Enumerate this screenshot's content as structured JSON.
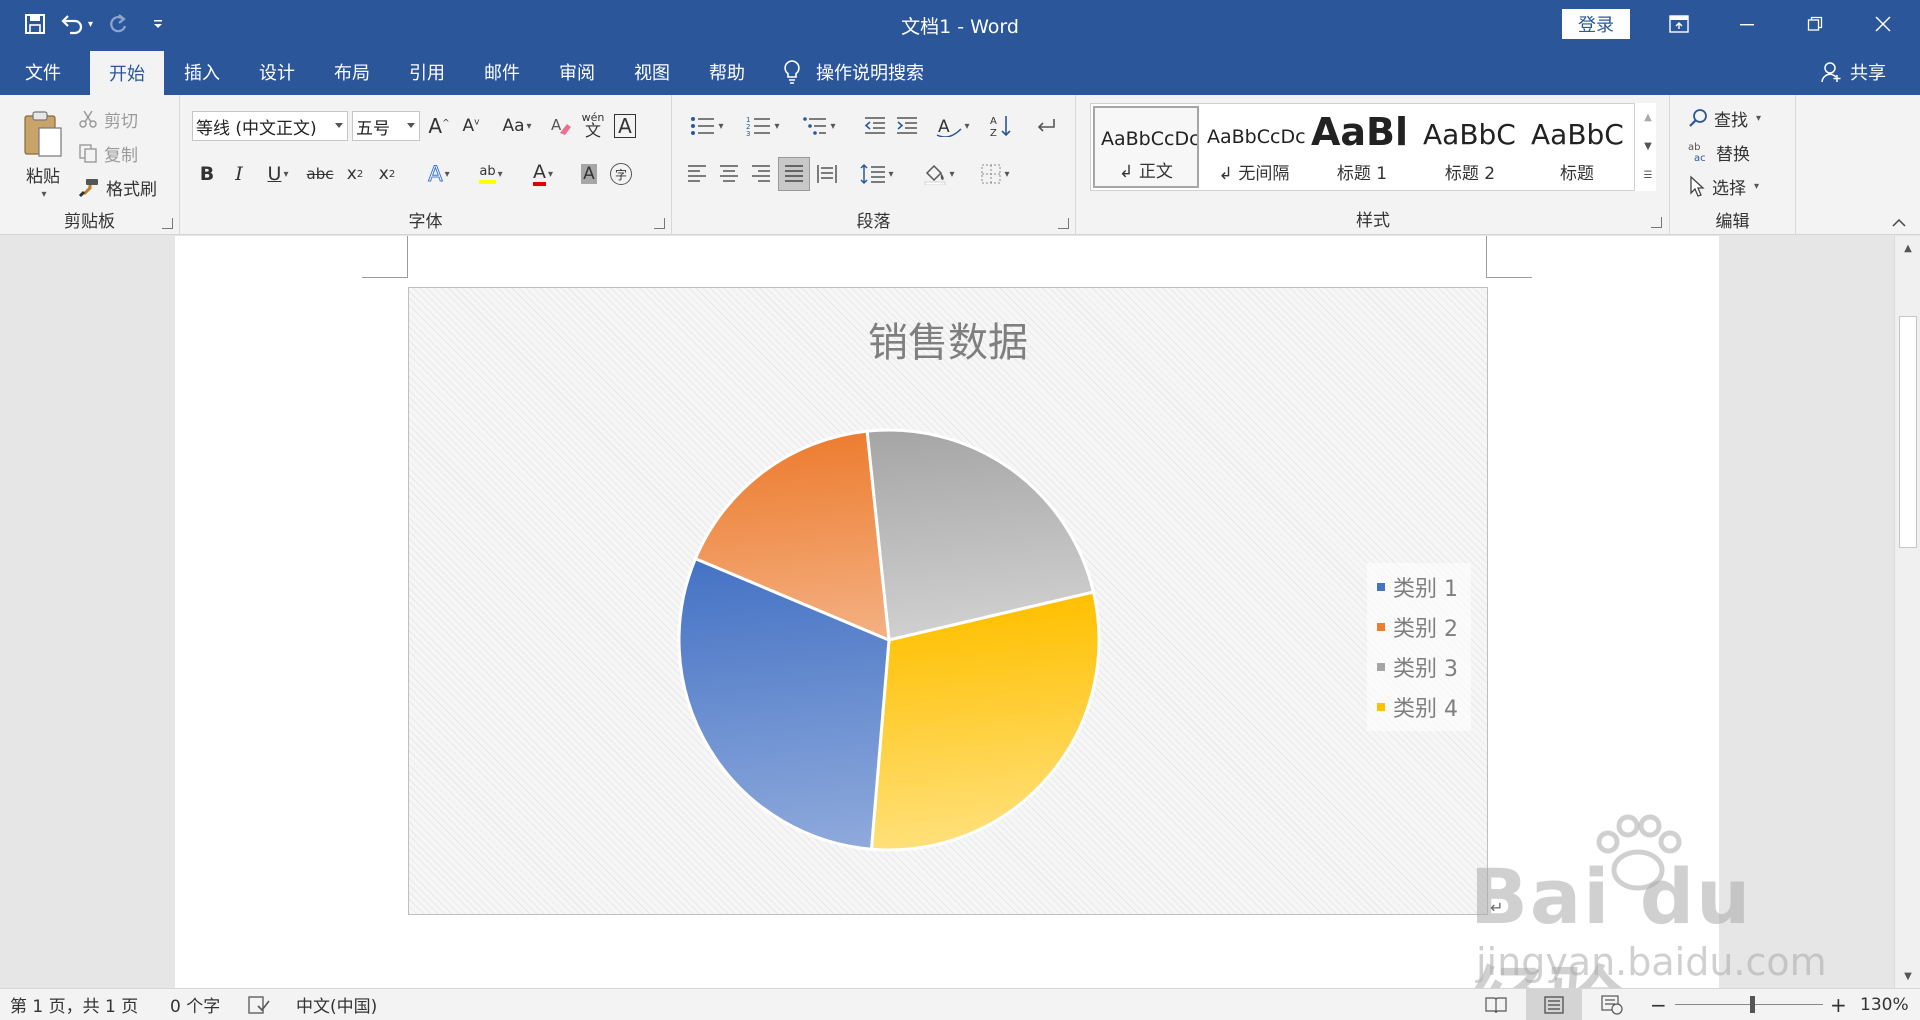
{
  "titlebar": {
    "doc_title": "文档1  -  Word",
    "login_label": "登录"
  },
  "tabs": [
    {
      "label": "文件"
    },
    {
      "label": "开始"
    },
    {
      "label": "插入"
    },
    {
      "label": "设计"
    },
    {
      "label": "布局"
    },
    {
      "label": "引用"
    },
    {
      "label": "邮件"
    },
    {
      "label": "审阅"
    },
    {
      "label": "视图"
    },
    {
      "label": "帮助"
    }
  ],
  "active_tab": "开始",
  "tell_me": "操作说明搜索",
  "share_label": "共享",
  "ribbon": {
    "clipboard": {
      "label": "剪贴板",
      "paste": "粘贴",
      "cut": "剪切",
      "copy": "复制",
      "format_painter": "格式刷"
    },
    "font": {
      "label": "字体",
      "font_name": "等线 (中文正文)",
      "font_size": "五号",
      "case_btn": "Aa",
      "phonetic_top": "wén",
      "phonetic_bottom": "文",
      "char_border": "A",
      "bold": "B",
      "italic": "I",
      "underline": "U",
      "strike": "abc",
      "subscript": "x",
      "superscript": "x",
      "text_effect": "A",
      "highlight": "ab",
      "font_color": "A",
      "char_shading": "A",
      "enclose": "字"
    },
    "paragraph": {
      "label": "段落"
    },
    "styles": {
      "label": "样式",
      "items": [
        {
          "sample": "AaBbCcDc",
          "name": "↲ 正文"
        },
        {
          "sample": "AaBbCcDc",
          "name": "↲ 无间隔"
        },
        {
          "sample": "AaBl",
          "name": "标题 1"
        },
        {
          "sample": "AaBbC",
          "name": "标题 2"
        },
        {
          "sample": "AaBbC",
          "name": "标题"
        }
      ]
    },
    "editing": {
      "label": "编辑",
      "find": "查找",
      "replace": "替换",
      "select": "选择"
    }
  },
  "chart_data": {
    "type": "pie",
    "title": "销售数据",
    "categories": [
      "类别 1",
      "类别 2",
      "类别 3",
      "类别 4"
    ],
    "values": [
      30,
      17,
      23,
      30
    ],
    "colors": [
      "#4472c4",
      "#ed7d31",
      "#a5a5a5",
      "#ffc000"
    ],
    "colors_light": [
      "#8faadc",
      "#f4b183",
      "#d0d0d0",
      "#ffe07a"
    ],
    "legend_position": "right"
  },
  "statusbar": {
    "page": "第 1 页，共 1 页",
    "words": "0 个字",
    "language": "中文(中国)",
    "zoom": "130%"
  },
  "watermark": {
    "brand": "Bai  du 经验",
    "url": "jingyan.baidu.com"
  }
}
